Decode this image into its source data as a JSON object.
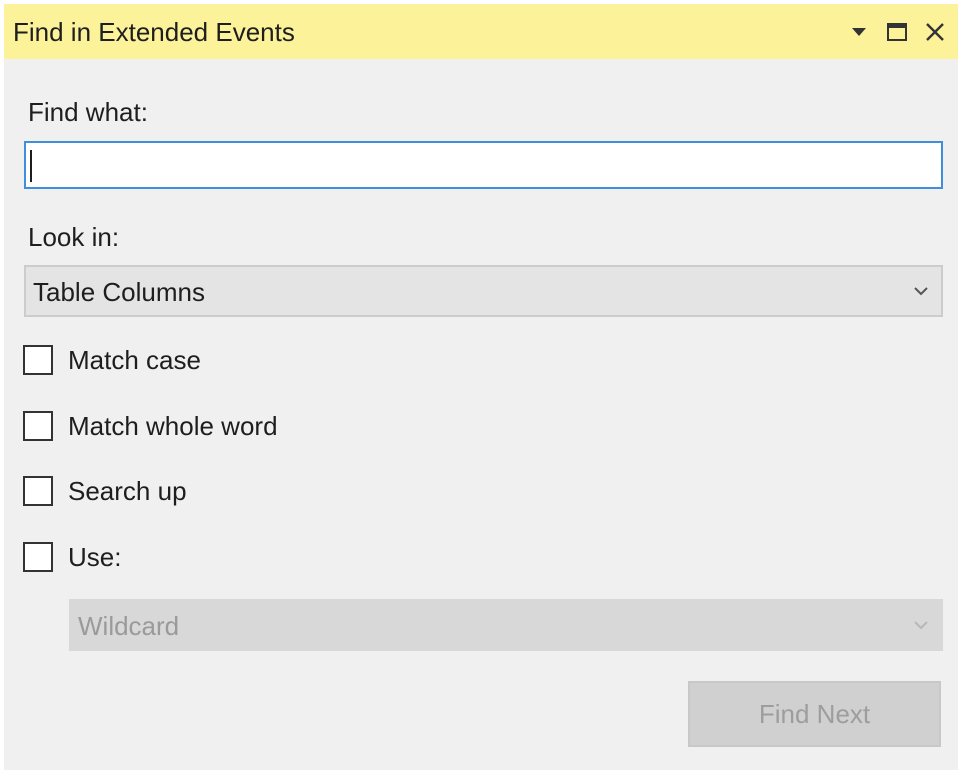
{
  "window": {
    "title": "Find in Extended Events",
    "title_bar_color": "#fcf29a",
    "controls": {
      "dropdown_icon": "caret-down-icon",
      "maximize_icon": "maximize-icon",
      "close_icon": "close-icon"
    }
  },
  "find_what": {
    "label": "Find what:",
    "value": "",
    "focused": true
  },
  "look_in": {
    "label": "Look in:",
    "selected": "Table Columns",
    "options": [
      "Table Columns"
    ]
  },
  "options": {
    "match_case": {
      "label": "Match case",
      "checked": false
    },
    "match_whole_word": {
      "label": "Match whole word",
      "checked": false
    },
    "search_up": {
      "label": "Search up",
      "checked": false
    },
    "use": {
      "label": "Use:",
      "checked": false
    }
  },
  "use_mode": {
    "selected": "Wildcard",
    "enabled": false
  },
  "actions": {
    "find_next_label": "Find Next",
    "find_next_enabled": false
  }
}
